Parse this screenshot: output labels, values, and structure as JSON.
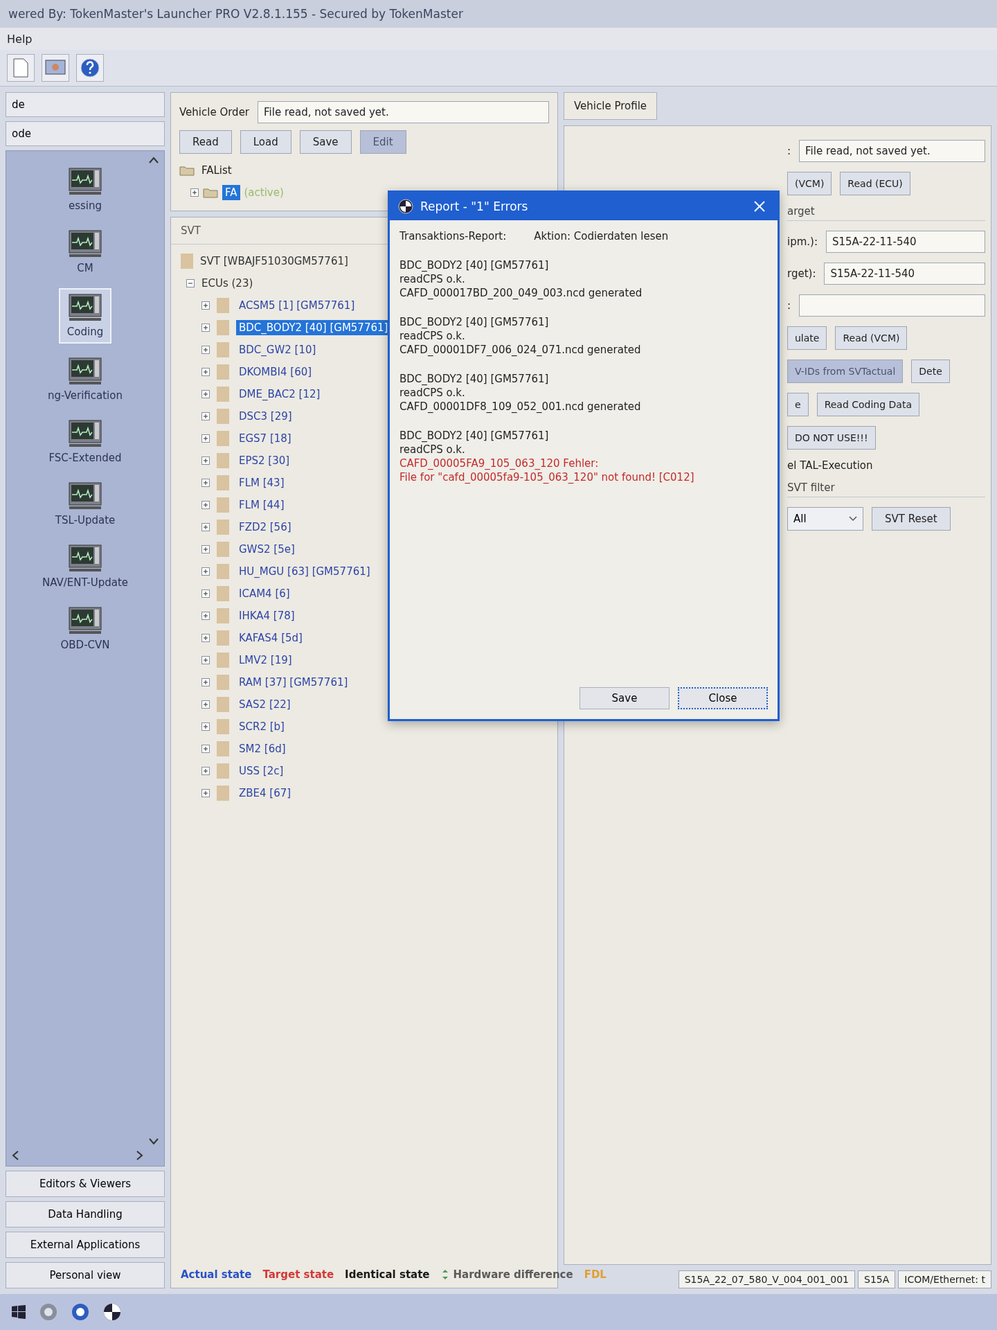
{
  "window": {
    "title": "wered By: TokenMaster's Launcher PRO V2.8.1.155 - Secured by TokenMaster"
  },
  "menu": [
    {
      "label": "Help"
    }
  ],
  "sidebar": {
    "tabs": [
      {
        "label": "de"
      },
      {
        "label": "ode"
      }
    ],
    "items": [
      {
        "label": "essing",
        "selected": false
      },
      {
        "label": "CM",
        "selected": false
      },
      {
        "label": "Coding",
        "selected": true
      },
      {
        "label": "ng-Verification",
        "selected": false
      },
      {
        "label": "FSC-Extended",
        "selected": false
      },
      {
        "label": "TSL-Update",
        "selected": false
      },
      {
        "label": "NAV/ENT-Update",
        "selected": false
      },
      {
        "label": "OBD-CVN",
        "selected": false
      }
    ],
    "sections": [
      "Editors & Viewers",
      "Data Handling",
      "External Applications",
      "Personal view"
    ]
  },
  "vehicle_order": {
    "label": "Vehicle Order",
    "status": "File read, not saved yet.",
    "buttons": [
      {
        "label": "Read",
        "disabled": false
      },
      {
        "label": "Load",
        "disabled": false
      },
      {
        "label": "Save",
        "disabled": false
      },
      {
        "label": "Edit",
        "disabled": true
      }
    ],
    "fa_tree": {
      "label": "FAList",
      "children": [
        {
          "label": "FA",
          "note": "(active)",
          "selected": true,
          "expanded": false
        }
      ]
    }
  },
  "svt": {
    "title": "SVT",
    "root": "SVT [WBAJF51030GM57761]",
    "ecus": {
      "label": "ECUs (23)",
      "expanded": true,
      "children": [
        {
          "label": "ACSM5 [1] [GM57761]",
          "selected": false,
          "expanded": false
        },
        {
          "label": "BDC_BODY2 [40] [GM57761]",
          "selected": true,
          "expanded": false
        },
        {
          "label": "BDC_GW2 [10]",
          "selected": false,
          "expanded": false
        },
        {
          "label": "DKOMBI4 [60]",
          "selected": false,
          "expanded": false
        },
        {
          "label": "DME_BAC2 [12]",
          "selected": false,
          "expanded": false
        },
        {
          "label": "DSC3 [29]",
          "selected": false,
          "expanded": false
        },
        {
          "label": "EGS7 [18]",
          "selected": false,
          "expanded": false
        },
        {
          "label": "EPS2 [30]",
          "selected": false,
          "expanded": false
        },
        {
          "label": "FLM [43]",
          "selected": false,
          "expanded": false
        },
        {
          "label": "FLM [44]",
          "selected": false,
          "expanded": false
        },
        {
          "label": "FZD2 [56]",
          "selected": false,
          "expanded": false
        },
        {
          "label": "GWS2 [5e]",
          "selected": false,
          "expanded": false
        },
        {
          "label": "HU_MGU [63] [GM57761]",
          "selected": false,
          "expanded": false
        },
        {
          "label": "ICAM4 [6]",
          "selected": false,
          "expanded": false
        },
        {
          "label": "IHKA4 [78]",
          "selected": false,
          "expanded": false
        },
        {
          "label": "KAFAS4 [5d]",
          "selected": false,
          "expanded": false
        },
        {
          "label": "LMV2 [19]",
          "selected": false,
          "expanded": false
        },
        {
          "label": "RAM [37] [GM57761]",
          "selected": false,
          "expanded": false
        },
        {
          "label": "SAS2 [22]",
          "selected": false,
          "expanded": false
        },
        {
          "label": "SCR2 [b]",
          "selected": false,
          "expanded": false
        },
        {
          "label": "SM2 [6d]",
          "selected": false,
          "expanded": false
        },
        {
          "label": "USS [2c]",
          "selected": false,
          "expanded": false
        },
        {
          "label": "ZBE4 [67]",
          "selected": false,
          "expanded": false
        }
      ]
    }
  },
  "legend": [
    {
      "label": "Actual state",
      "kind": "text",
      "color": "#2a52c8"
    },
    {
      "label": "Target state",
      "kind": "text",
      "color": "#d23a3a"
    },
    {
      "label": "Identical state",
      "kind": "text",
      "color": "#1a1a1a"
    },
    {
      "label": "Hardware difference",
      "kind": "icon",
      "color": "#5a5a5a"
    },
    {
      "label": "FDL",
      "kind": "text",
      "color": "#e0a030"
    }
  ],
  "vehicle_profile": {
    "title": "Vehicle Profile",
    "rows": [
      {
        "kind": "field",
        "label": ":",
        "value": "File read, not saved yet."
      },
      {
        "kind": "buttons",
        "buttons": [
          {
            "label": "(VCM)",
            "disabled": false
          },
          {
            "label": "Read (ECU)",
            "disabled": false
          }
        ]
      },
      {
        "kind": "group",
        "label": "arget"
      },
      {
        "kind": "field",
        "label": "ipm.):",
        "value": "S15A-22-11-540"
      },
      {
        "kind": "field",
        "label": "rget):",
        "value": "S15A-22-11-540"
      },
      {
        "kind": "field",
        "label": ":"
      },
      {
        "kind": "buttons",
        "buttons": [
          {
            "label": "ulate",
            "disabled": false
          },
          {
            "label": "Read (VCM)",
            "disabled": false
          }
        ]
      },
      {
        "kind": "buttons",
        "buttons": [
          {
            "label": "V-IDs from SVTactual",
            "disabled": true
          },
          {
            "label": "Dete",
            "disabled": false
          }
        ]
      },
      {
        "kind": "buttons",
        "buttons": [
          {
            "label": "e",
            "disabled": false
          },
          {
            "label": "Read Coding Data",
            "disabled": false
          }
        ]
      },
      {
        "kind": "buttons",
        "buttons": [
          {
            "label": "DO NOT USE!!!",
            "disabled": false
          }
        ]
      },
      {
        "kind": "text",
        "label": "el TAL-Execution"
      },
      {
        "kind": "group",
        "label": "SVT filter"
      },
      {
        "kind": "filter",
        "select": "All",
        "button": "SVT Reset"
      }
    ]
  },
  "status_bar": [
    "S15A_22_07_580_V_004_001_001",
    "S15A",
    "ICOM/Ethernet: t"
  ],
  "dialog": {
    "title": "Report - \"1\" Errors",
    "report_label": "Transaktions-Report:",
    "action": "Aktion: Codierdaten lesen",
    "entries": [
      {
        "lines": [
          {
            "text": "BDC_BODY2 [40] [GM57761]",
            "error": false
          },
          {
            "text": "readCPS o.k.",
            "error": false
          },
          {
            "text": "CAFD_000017BD_200_049_003.ncd generated",
            "error": false
          }
        ]
      },
      {
        "lines": [
          {
            "text": "BDC_BODY2 [40] [GM57761]",
            "error": false
          },
          {
            "text": "readCPS o.k.",
            "error": false
          },
          {
            "text": "CAFD_00001DF7_006_024_071.ncd generated",
            "error": false
          }
        ]
      },
      {
        "lines": [
          {
            "text": "BDC_BODY2 [40] [GM57761]",
            "error": false
          },
          {
            "text": "readCPS o.k.",
            "error": false
          },
          {
            "text": "CAFD_00001DF8_109_052_001.ncd generated",
            "error": false
          }
        ]
      },
      {
        "lines": [
          {
            "text": "BDC_BODY2 [40] [GM57761]",
            "error": false
          },
          {
            "text": "readCPS o.k.",
            "error": false
          },
          {
            "text": "CAFD_00005FA9_105_063_120 Fehler:",
            "error": true
          },
          {
            "text": "File for \"cafd_00005fa9-105_063_120\" not found! [C012]",
            "error": true
          }
        ]
      }
    ],
    "buttons": [
      {
        "label": "Save",
        "focused": false
      },
      {
        "label": "Close",
        "focused": true
      }
    ]
  }
}
